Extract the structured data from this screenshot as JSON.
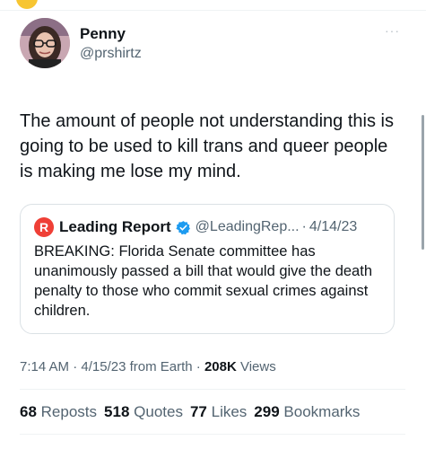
{
  "tweet": {
    "display_name": "Penny",
    "handle": "@prshirtz",
    "more_label": "···",
    "text": "The amount of people not understanding this is going to be used to kill trans and queer people is making me lose my mind."
  },
  "quote": {
    "logo_letter": "R",
    "display_name": "Leading Report",
    "handle": "@LeadingRep...",
    "separator": "·",
    "date": "4/14/23",
    "text": "BREAKING: Florida Senate committee has unanimously passed a bill that would give the death penalty to those who commit sexual crimes against children."
  },
  "meta": {
    "time": "7:14 AM",
    "sep1": " · ",
    "date": "4/15/23",
    "source": " from Earth",
    "sep2": " · ",
    "views_count": "208K",
    "views_label": " Views"
  },
  "stats": [
    {
      "count": "68",
      "label": "Reposts"
    },
    {
      "count": "518",
      "label": "Quotes"
    },
    {
      "count": "77",
      "label": "Likes"
    },
    {
      "count": "299",
      "label": "Bookmarks"
    }
  ],
  "colors": {
    "text": "#0f1419",
    "secondary": "#536471",
    "verified": "#1d9bf0",
    "logo": "#ef3f36",
    "border": "#dbe1e5"
  }
}
